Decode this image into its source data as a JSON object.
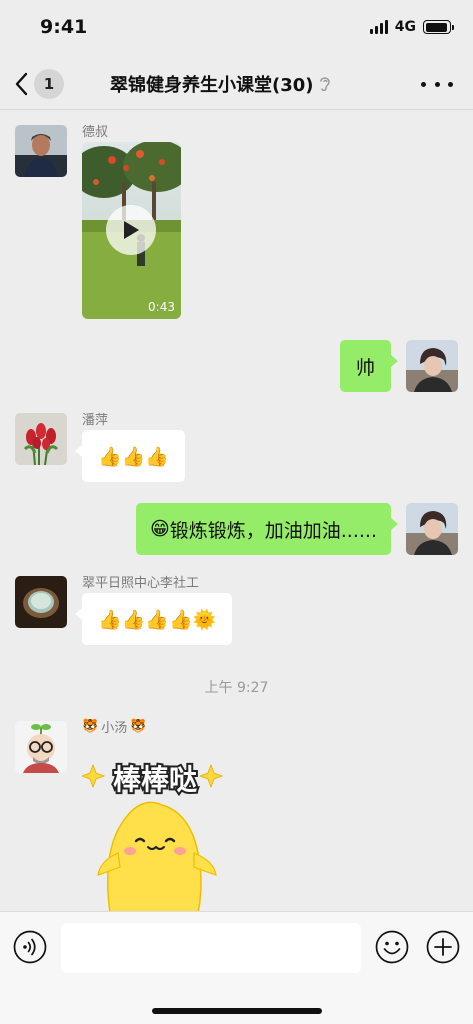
{
  "status": {
    "time": "9:41",
    "network": "4G",
    "battery_level": 0.95
  },
  "nav": {
    "back_count": "1",
    "title": "翠锦健身养生小课堂(30)"
  },
  "messages": {
    "m1": {
      "sender": "德叔",
      "video_duration": "0:43"
    },
    "m2": {
      "text": "帅"
    },
    "m3": {
      "sender": "潘萍",
      "emojis": "👍👍👍"
    },
    "m4": {
      "emoji": "😁",
      "text": "锻炼锻炼，加油加油......"
    },
    "m5": {
      "sender": "翠平日照中心李社工",
      "emojis": "👍👍👍👍🌞"
    },
    "time_separator": "上午 9:27",
    "m6": {
      "sender_emoji": "🐯",
      "sender": "小汤",
      "sticker_text": "棒棒哒"
    }
  },
  "input": {
    "placeholder": ""
  },
  "icons": {
    "back": "chevron-left-icon",
    "mute": "ear-muted-icon",
    "more": "more-dots-icon",
    "voice": "voice-icon",
    "emoji": "emoji-icon",
    "plus": "plus-icon"
  },
  "colors": {
    "bubble_green": "#95ec69",
    "background": "#ededed"
  }
}
